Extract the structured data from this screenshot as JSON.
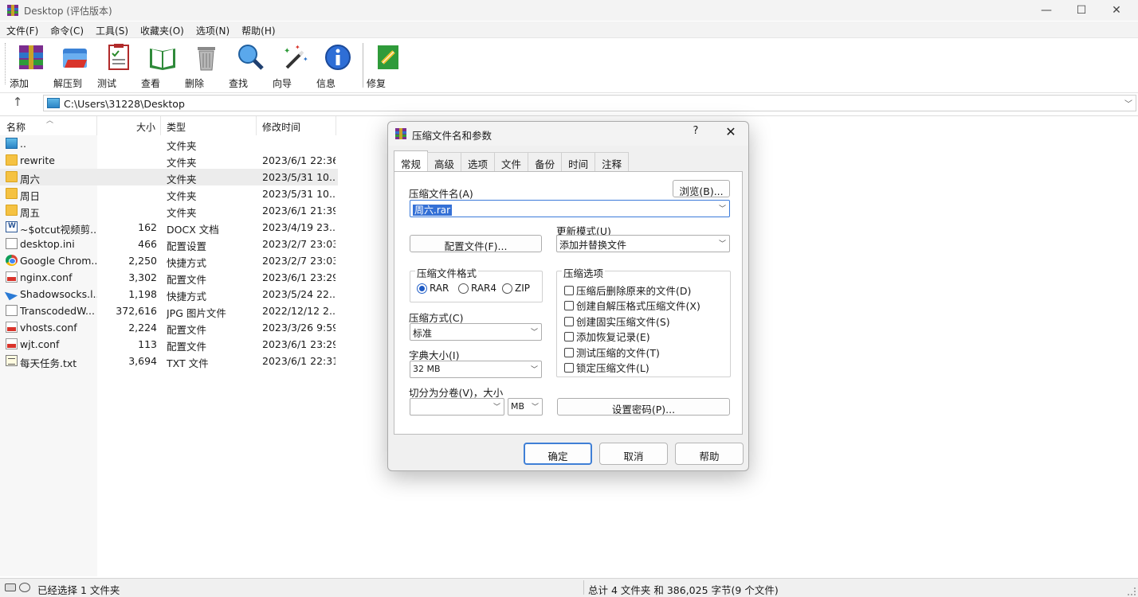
{
  "window": {
    "title": "Desktop (评估版本)"
  },
  "menu": [
    "文件(F)",
    "命令(C)",
    "工具(S)",
    "收藏夹(O)",
    "选项(N)",
    "帮助(H)"
  ],
  "toolbar": [
    "添加",
    "解压到",
    "测试",
    "查看",
    "删除",
    "查找",
    "向导",
    "信息",
    "修复"
  ],
  "address": {
    "path": "C:\\Users\\31228\\Desktop"
  },
  "filelist": {
    "columns": {
      "name": "名称",
      "size": "大小",
      "type": "类型",
      "modified": "修改时间"
    },
    "rows": [
      {
        "name": "..",
        "size": "",
        "type": "文件夹",
        "modified": "",
        "icon": "up-folder-icon"
      },
      {
        "name": "rewrite",
        "size": "",
        "type": "文件夹",
        "modified": "2023/6/1 22:36",
        "icon": "folder-icon"
      },
      {
        "name": "周六",
        "size": "",
        "type": "文件夹",
        "modified": "2023/5/31 10...",
        "icon": "folder-icon",
        "selected": true
      },
      {
        "name": "周日",
        "size": "",
        "type": "文件夹",
        "modified": "2023/5/31 10...",
        "icon": "folder-icon"
      },
      {
        "name": "周五",
        "size": "",
        "type": "文件夹",
        "modified": "2023/6/1 21:39",
        "icon": "folder-icon"
      },
      {
        "name": "~$otcut视频剪...",
        "size": "162",
        "type": "DOCX 文档",
        "modified": "2023/4/19 23...",
        "icon": "word-doc-icon"
      },
      {
        "name": "desktop.ini",
        "size": "466",
        "type": "配置设置",
        "modified": "2023/2/7 23:03",
        "icon": "ini-file-icon"
      },
      {
        "name": "Google Chrom...",
        "size": "2,250",
        "type": "快捷方式",
        "modified": "2023/2/7 23:03",
        "icon": "chrome-icon"
      },
      {
        "name": "nginx.conf",
        "size": "3,302",
        "type": "配置文件",
        "modified": "2023/6/1 23:29",
        "icon": "conf-file-icon"
      },
      {
        "name": "Shadowsocks.l...",
        "size": "1,198",
        "type": "快捷方式",
        "modified": "2023/5/24 22...",
        "icon": "shortcut-icon"
      },
      {
        "name": "TranscodedW...",
        "size": "372,616",
        "type": "JPG 图片文件",
        "modified": "2022/12/12 2...",
        "icon": "file-icon"
      },
      {
        "name": "vhosts.conf",
        "size": "2,224",
        "type": "配置文件",
        "modified": "2023/3/26 9:59",
        "icon": "conf-file-icon"
      },
      {
        "name": "wjt.conf",
        "size": "113",
        "type": "配置文件",
        "modified": "2023/6/1 23:29",
        "icon": "conf-file-icon"
      },
      {
        "name": "每天任务.txt",
        "size": "3,694",
        "type": "TXT 文件",
        "modified": "2023/6/1 22:31",
        "icon": "txt-file-icon"
      }
    ]
  },
  "status": {
    "left": "已经选择 1 文件夹",
    "right": "总计 4 文件夹 和 386,025 字节(9 个文件)"
  },
  "dialog": {
    "title": "压缩文件名和参数",
    "help": "?",
    "tabs": [
      "常规",
      "高级",
      "选项",
      "文件",
      "备份",
      "时间",
      "注释"
    ],
    "archive_name_label": "压缩文件名(A)",
    "browse": "浏览(B)...",
    "archive_name_value": "周六.rar",
    "update_mode_label": "更新模式(U)",
    "update_mode_value": "添加并替换文件",
    "profiles": "配置文件(F)...",
    "format_label": "压缩文件格式",
    "formats": [
      "RAR",
      "RAR4",
      "ZIP"
    ],
    "format_selected": "RAR",
    "method_label": "压缩方式(C)",
    "method_value": "标准",
    "dict_label": "字典大小(I)",
    "dict_value": "32 MB",
    "split_label": "切分为分卷(V)，大小",
    "split_value": "",
    "split_unit": "MB",
    "options_label": "压缩选项",
    "options": [
      "压缩后删除原来的文件(D)",
      "创建自解压格式压缩文件(X)",
      "创建固实压缩文件(S)",
      "添加恢复记录(E)",
      "测试压缩的文件(T)",
      "锁定压缩文件(L)"
    ],
    "password": "设置密码(P)...",
    "ok": "确定",
    "cancel": "取消",
    "helpbtn": "帮助"
  }
}
